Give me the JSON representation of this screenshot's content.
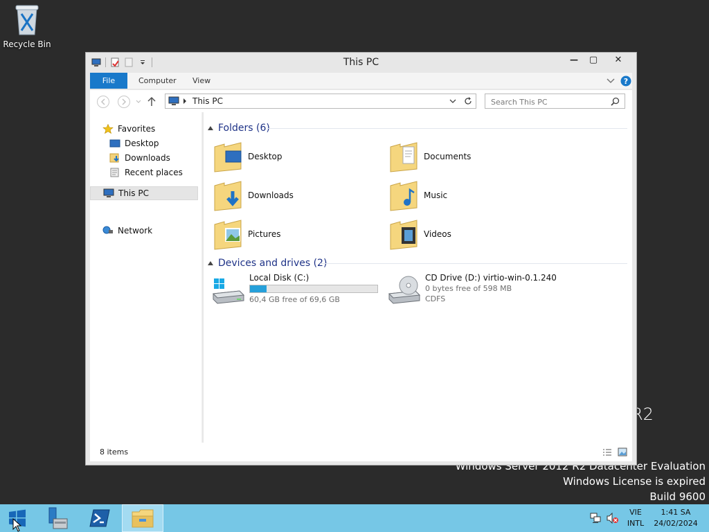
{
  "desktop": {
    "recycle_bin_label": "Recycle Bin",
    "watermark_partial": "R2",
    "watermark_line1": "Windows Server 2012 R2 Datacenter Evaluation",
    "watermark_line2": "Windows License is expired",
    "watermark_line3": "Build 9600"
  },
  "window": {
    "title": "This PC",
    "buttons": {
      "minimize": "—",
      "maximize": "▢",
      "close": "✕"
    },
    "ribbon_tabs": [
      "File",
      "Computer",
      "View"
    ],
    "address": {
      "path": "This PC"
    },
    "search": {
      "placeholder": "Search This PC"
    },
    "nav": {
      "favorites_label": "Favorites",
      "favorites": [
        "Desktop",
        "Downloads",
        "Recent places"
      ],
      "this_pc_label": "This PC",
      "network_label": "Network"
    },
    "folders_header": "Folders (6)",
    "folders": [
      {
        "name": "Desktop",
        "icon": "desktop-folder-icon"
      },
      {
        "name": "Documents",
        "icon": "documents-folder-icon"
      },
      {
        "name": "Downloads",
        "icon": "downloads-folder-icon"
      },
      {
        "name": "Music",
        "icon": "music-folder-icon"
      },
      {
        "name": "Pictures",
        "icon": "pictures-folder-icon"
      },
      {
        "name": "Videos",
        "icon": "videos-folder-icon"
      }
    ],
    "drives_header": "Devices and drives (2)",
    "drives": [
      {
        "name": "Local Disk (C:)",
        "free_text": "60,4 GB free of 69,6 GB",
        "used_fraction": 0.13
      },
      {
        "name": "CD Drive (D:) virtio-win-0.1.240",
        "free_text": "0 bytes free of 598 MB",
        "fs": "CDFS"
      }
    ],
    "status": {
      "items": "8 items"
    }
  },
  "taskbar": {
    "lang_top": "VIE",
    "lang_bottom": "INTL",
    "time": "1:41 SA",
    "date": "24/02/2024"
  },
  "colors": {
    "accent": "#1979ca",
    "taskbar": "#76c7e6",
    "group_header": "#1e3287",
    "progress": "#26a0da"
  }
}
